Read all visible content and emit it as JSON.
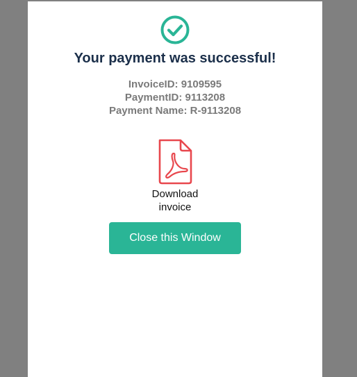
{
  "modal": {
    "title": "Your payment was successful!",
    "details": [
      "InvoiceID: 9109595",
      "PaymentID: 9113208",
      "Payment Name: R-9113208"
    ],
    "download": {
      "label_line1": "Download",
      "label_line2": "invoice",
      "icon": "pdf-file-icon"
    },
    "close_button_label": "Close this Window",
    "success_icon": "check-circle-icon"
  },
  "colors": {
    "accent": "#2ab596",
    "title": "#1b2f4a",
    "details": "#7a7a7a",
    "pdf_icon": "#e8474d",
    "backdrop": "#808080"
  }
}
